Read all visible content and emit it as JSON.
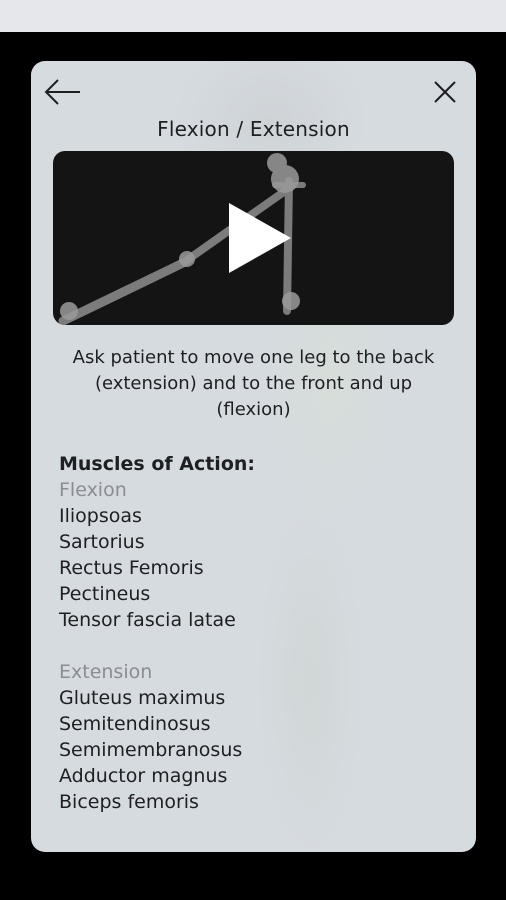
{
  "dialog": {
    "title": "Flexion / Extension",
    "instructions": "Ask patient to move one leg to the back (extension) and to the front and up (flexion)"
  },
  "muscles": {
    "heading": "Muscles of Action:",
    "flexion": {
      "label": "Flexion",
      "items": [
        "Iliopsoas",
        "Sartorius",
        "Rectus Femoris",
        "Pectineus",
        "Tensor fascia latae"
      ]
    },
    "extension": {
      "label": "Extension",
      "items": [
        "Gluteus maximus",
        "Semitendinosus",
        "Semimembranosus",
        "Adductor magnus",
        "Biceps femoris"
      ]
    }
  },
  "icons": {
    "back": "arrow-left-icon",
    "close": "close-icon",
    "play": "play-icon"
  },
  "colors": {
    "card_background": "#d6dbe0",
    "video_background": "#141414",
    "text": "#1e1f22",
    "subheading": "#8a8d92"
  }
}
